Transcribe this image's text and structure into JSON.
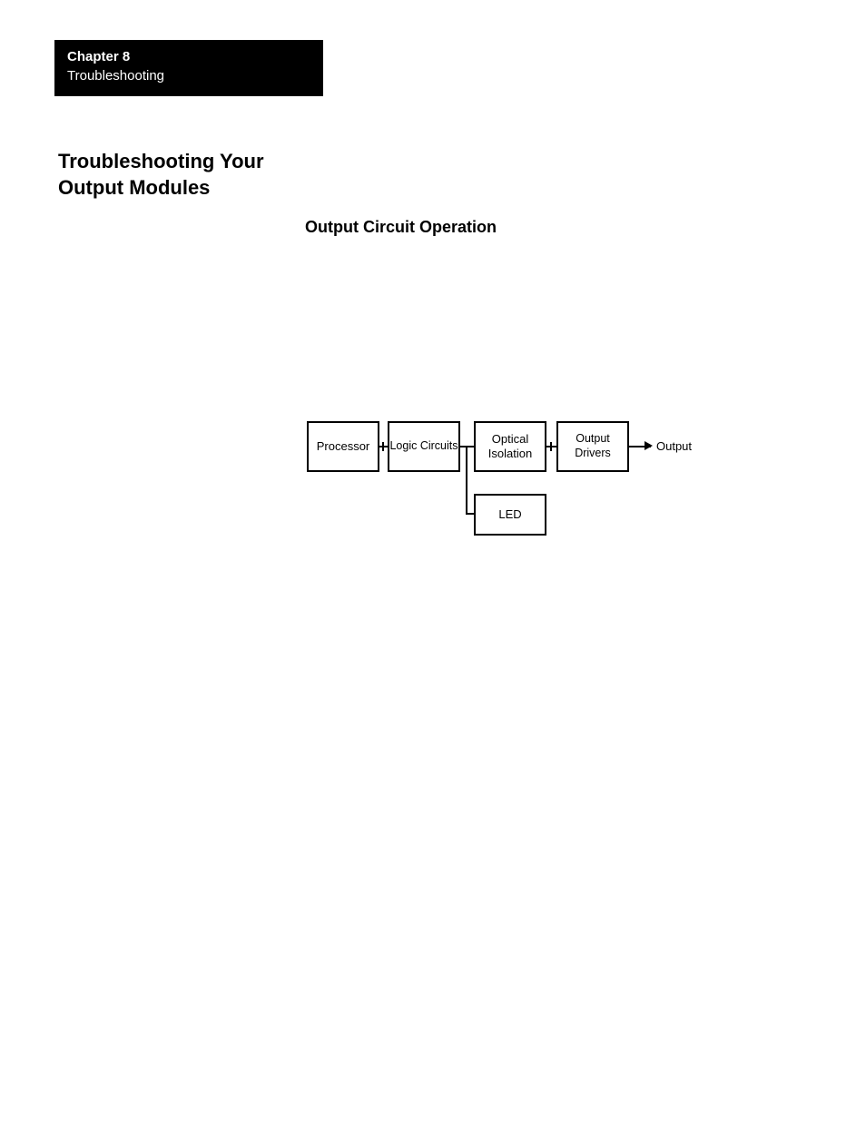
{
  "header": {
    "chapter_label": "Chapter  8",
    "chapter_subtitle": "Troubleshooting"
  },
  "page": {
    "title": "Troubleshooting Your Output Modules",
    "section_heading": "Output Circuit Operation"
  },
  "diagram": {
    "blocks": {
      "processor": "Processor",
      "logic": "Logic Circuits",
      "optical": "Optical\nIsolation",
      "drivers": "Output Drivers",
      "led": "LED"
    },
    "output_label": "Output"
  }
}
